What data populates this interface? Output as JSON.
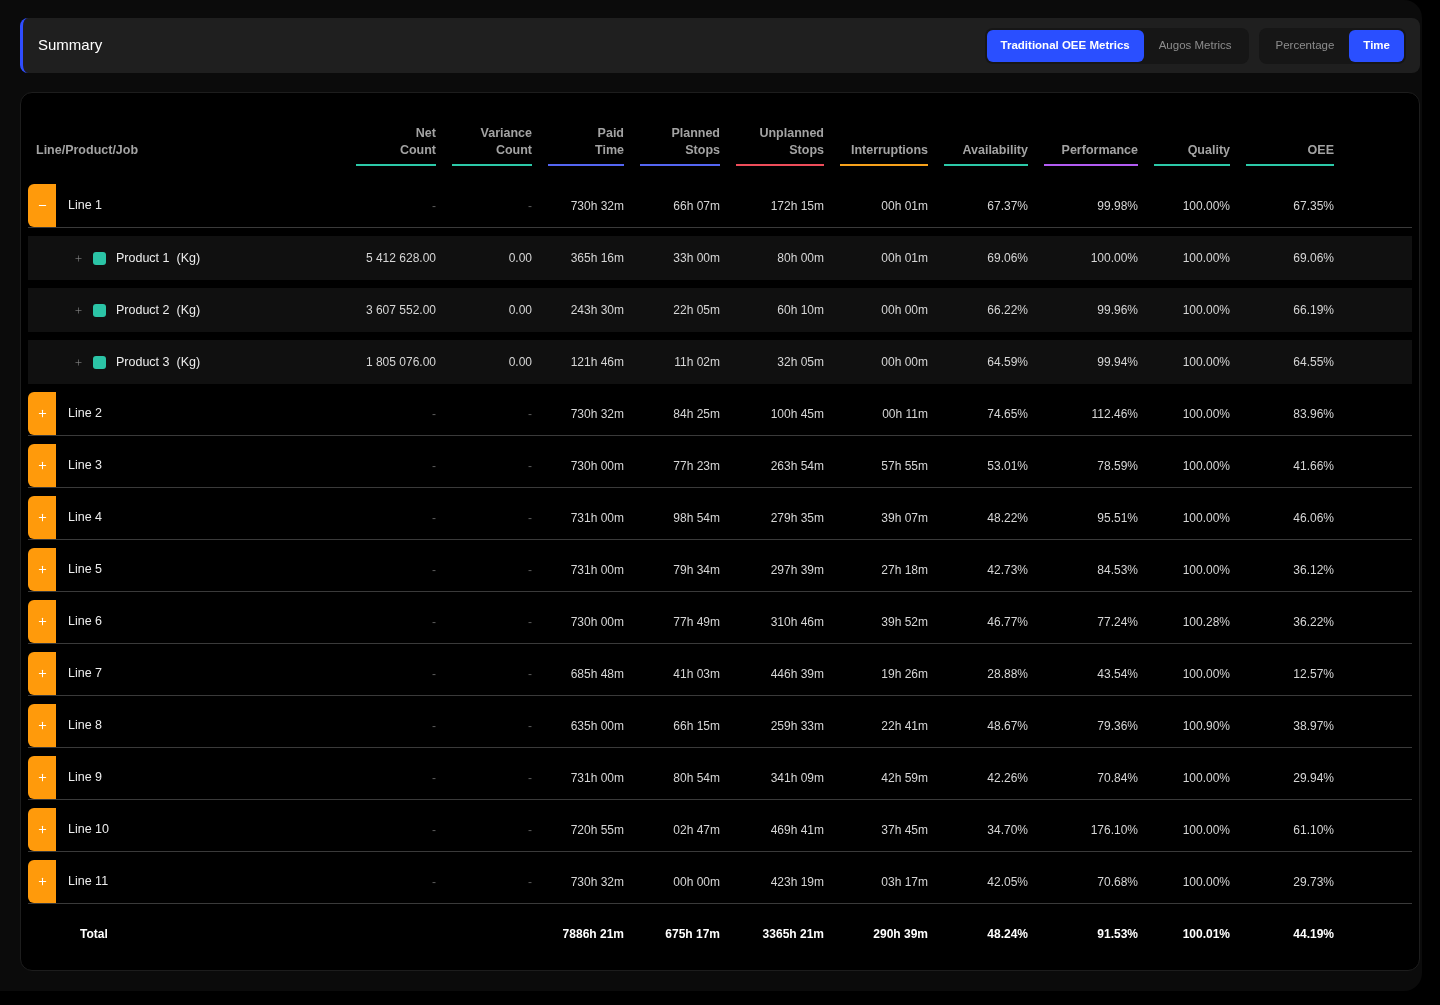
{
  "header": {
    "title": "Summary",
    "toggle_groups": [
      {
        "options": [
          {
            "label": "Traditional OEE Metrics",
            "selected": true
          },
          {
            "label": "Augos Metrics",
            "selected": false
          }
        ]
      },
      {
        "options": [
          {
            "label": "Percentage",
            "selected": false
          },
          {
            "label": "Time",
            "selected": true
          }
        ]
      }
    ]
  },
  "table": {
    "first_column_header": "Line/Product/Job",
    "columns": [
      {
        "label": "Net Count",
        "color": "#2cc9a8"
      },
      {
        "label": "Variance Count",
        "color": "#2cc9a8"
      },
      {
        "label": "Paid Time",
        "color": "#5466f2"
      },
      {
        "label": "Planned Stops",
        "color": "#5466f2"
      },
      {
        "label": "Unplanned Stops",
        "color": "#ee4d5a"
      },
      {
        "label": "Interruptions",
        "color": "#f7a21b"
      },
      {
        "label": "Availability",
        "color": "#2cc9a8"
      },
      {
        "label": "Performance",
        "color": "#b25cf2"
      },
      {
        "label": "Quality",
        "color": "#2cc9a8"
      },
      {
        "label": "OEE",
        "color": "#2cc9a8"
      }
    ],
    "rows": [
      {
        "name": "Line 1",
        "expanded": true,
        "cells": [
          "-",
          "-",
          "730h 32m",
          "66h 07m",
          "172h 15m",
          "00h 01m",
          "67.37%",
          "99.98%",
          "100.00%",
          "67.35%"
        ],
        "children": [
          {
            "name": "Product 1",
            "unit": "(Kg)",
            "expanded": false,
            "cells": [
              "5 412 628.00",
              "0.00",
              "365h 16m",
              "33h 00m",
              "80h 00m",
              "00h 01m",
              "69.06%",
              "100.00%",
              "100.00%",
              "69.06%"
            ]
          },
          {
            "name": "Product 2",
            "unit": "(Kg)",
            "expanded": false,
            "cells": [
              "3 607 552.00",
              "0.00",
              "243h 30m",
              "22h 05m",
              "60h 10m",
              "00h 00m",
              "66.22%",
              "99.96%",
              "100.00%",
              "66.19%"
            ]
          },
          {
            "name": "Product 3",
            "unit": "(Kg)",
            "expanded": false,
            "cells": [
              "1 805 076.00",
              "0.00",
              "121h 46m",
              "11h 02m",
              "32h 05m",
              "00h 00m",
              "64.59%",
              "99.94%",
              "100.00%",
              "64.55%"
            ]
          }
        ]
      },
      {
        "name": "Line 2",
        "expanded": false,
        "cells": [
          "-",
          "-",
          "730h 32m",
          "84h 25m",
          "100h 45m",
          "00h 11m",
          "74.65%",
          "112.46%",
          "100.00%",
          "83.96%"
        ]
      },
      {
        "name": "Line 3",
        "expanded": false,
        "cells": [
          "-",
          "-",
          "730h 00m",
          "77h 23m",
          "263h 54m",
          "57h 55m",
          "53.01%",
          "78.59%",
          "100.00%",
          "41.66%"
        ]
      },
      {
        "name": "Line 4",
        "expanded": false,
        "cells": [
          "-",
          "-",
          "731h 00m",
          "98h 54m",
          "279h 35m",
          "39h 07m",
          "48.22%",
          "95.51%",
          "100.00%",
          "46.06%"
        ]
      },
      {
        "name": "Line 5",
        "expanded": false,
        "cells": [
          "-",
          "-",
          "731h 00m",
          "79h 34m",
          "297h 39m",
          "27h 18m",
          "42.73%",
          "84.53%",
          "100.00%",
          "36.12%"
        ]
      },
      {
        "name": "Line 6",
        "expanded": false,
        "cells": [
          "-",
          "-",
          "730h 00m",
          "77h 49m",
          "310h 46m",
          "39h 52m",
          "46.77%",
          "77.24%",
          "100.28%",
          "36.22%"
        ]
      },
      {
        "name": "Line 7",
        "expanded": false,
        "cells": [
          "-",
          "-",
          "685h 48m",
          "41h 03m",
          "446h 39m",
          "19h 26m",
          "28.88%",
          "43.54%",
          "100.00%",
          "12.57%"
        ]
      },
      {
        "name": "Line 8",
        "expanded": false,
        "cells": [
          "-",
          "-",
          "635h 00m",
          "66h 15m",
          "259h 33m",
          "22h 41m",
          "48.67%",
          "79.36%",
          "100.90%",
          "38.97%"
        ]
      },
      {
        "name": "Line 9",
        "expanded": false,
        "cells": [
          "-",
          "-",
          "731h 00m",
          "80h 54m",
          "341h 09m",
          "42h 59m",
          "42.26%",
          "70.84%",
          "100.00%",
          "29.94%"
        ]
      },
      {
        "name": "Line 10",
        "expanded": false,
        "cells": [
          "-",
          "-",
          "720h 55m",
          "02h 47m",
          "469h 41m",
          "37h 45m",
          "34.70%",
          "176.10%",
          "100.00%",
          "61.10%"
        ]
      },
      {
        "name": "Line 11",
        "expanded": false,
        "cells": [
          "-",
          "-",
          "730h 32m",
          "00h 00m",
          "423h 19m",
          "03h 17m",
          "42.05%",
          "70.68%",
          "100.00%",
          "29.73%"
        ]
      }
    ],
    "total": {
      "label": "Total",
      "cells": [
        "7886h 21m",
        "675h 17m",
        "3365h 21m",
        "290h 39m",
        "48.24%",
        "91.53%",
        "100.01%",
        "44.19%"
      ]
    }
  }
}
